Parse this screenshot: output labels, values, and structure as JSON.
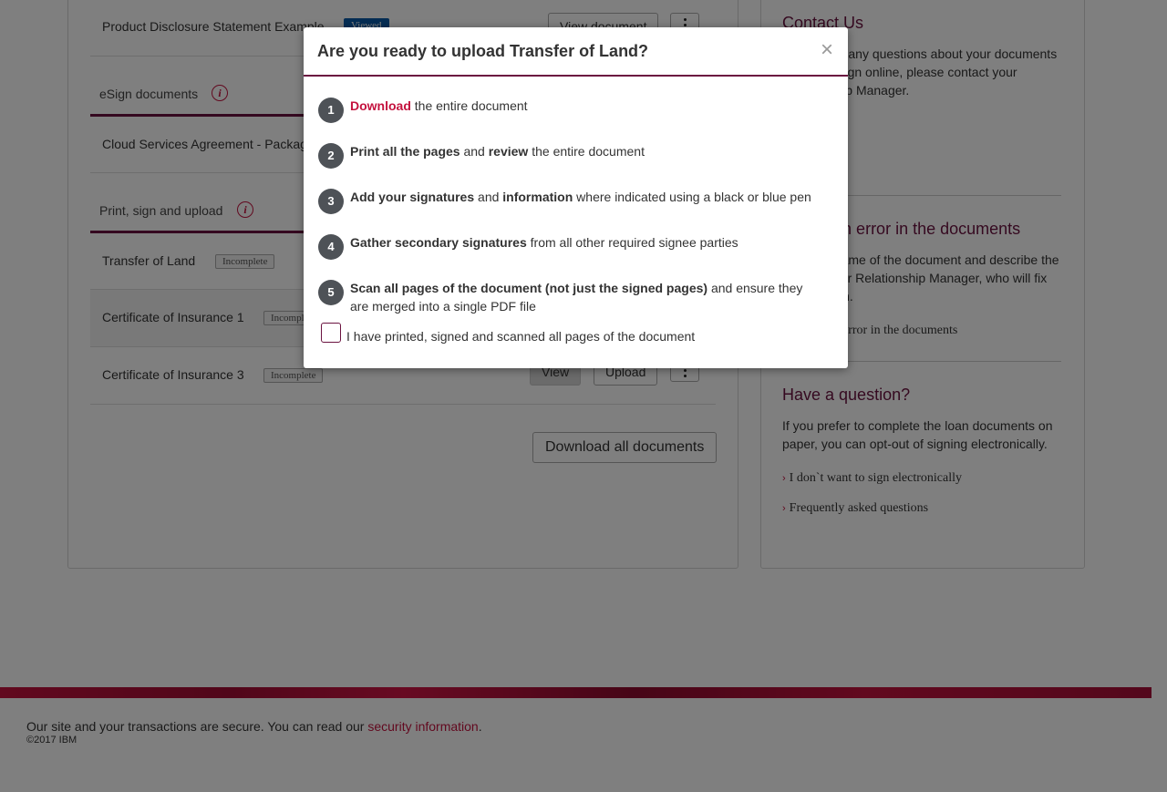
{
  "documents": {
    "pds": {
      "name": "Product Disclosure Statement Example",
      "badge": "Viewed",
      "button": "View document"
    },
    "esign_section": {
      "label": "eSign documents"
    },
    "cloud": {
      "name": "Cloud Services Agreement - Package"
    },
    "print_section": {
      "label": "Print, sign and upload"
    },
    "transfer": {
      "name": "Transfer of Land",
      "badge": "Incomplete"
    },
    "coi1": {
      "name": "Certificate of Insurance 1",
      "badge": "Incomplete"
    },
    "coi3": {
      "name": "Certificate of Insurance 3",
      "badge": "Incomplete",
      "view": "View",
      "upload": "Upload"
    },
    "download_all": "Download all documents"
  },
  "sidebar": {
    "contact": {
      "title": "Contact Us",
      "text": "If you have any questions about your documents or how to sign online, please contact your Relationship Manager."
    },
    "error": {
      "title": "Found an error in the documents",
      "text": "Note the name of the document and describe the error to your Relationship Manager, who will fix the problem.",
      "link": "Report an error in the documents"
    },
    "question": {
      "title": "Have a question?",
      "text": "If you prefer to complete the loan documents on paper, you can opt-out of signing electronically.",
      "link1": "I don`t want to sign electronically",
      "link2": "Frequently asked questions"
    }
  },
  "footer": {
    "text": "Our site and your transactions are secure. You can read our ",
    "link": "security information",
    "period": ".",
    "copyright": "©2017 IBM"
  },
  "modal": {
    "title": "Are you ready to upload Transfer of Land?",
    "close": "×",
    "steps": [
      {
        "num": "1",
        "a": "Download",
        "b": " the entire document"
      },
      {
        "num": "2",
        "a": "Print all the pages",
        "b": " and ",
        "c": "review",
        "d": " the entire document"
      },
      {
        "num": "3",
        "a": "Add your signatures",
        "b": " and ",
        "c": "information",
        "d": " where indicated using a black or blue pen"
      },
      {
        "num": "4",
        "a": "Gather secondary signatures",
        "b": " from all other required signee parties"
      },
      {
        "num": "5",
        "a": "Scan all pages of the document (not just the signed pages)",
        "b": " and ensure they are merged into a single PDF file"
      }
    ],
    "checkbox_label": "I have printed, signed and scanned all pages of the document"
  },
  "colors": {
    "accent": "#c4123e",
    "brand": "#6b1340",
    "badge_viewed": "#0a5aa8"
  }
}
